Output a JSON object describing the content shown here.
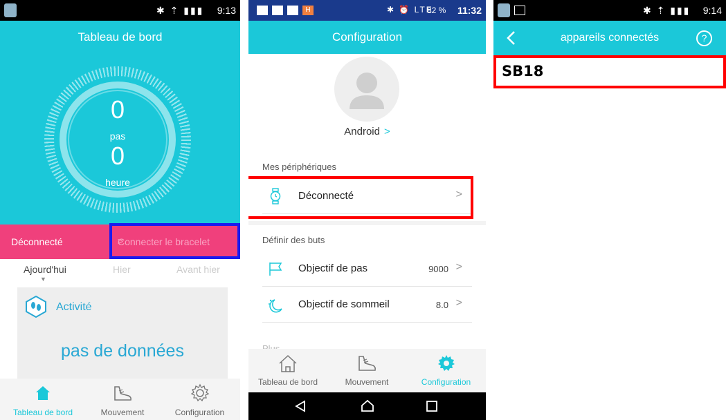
{
  "colors": {
    "accent": "#1bc8d9",
    "disconnect_bar": "#f0407c",
    "highlight_red": "#ff0000",
    "highlight_blue": "#1a1aee"
  },
  "phone1": {
    "status": {
      "icons": "✱ ⇡ ▮▮▮",
      "time": "9:13"
    },
    "title": "Tableau de bord",
    "steps_value": "0",
    "steps_label": "pas",
    "hours_value": "0",
    "hours_label": "heure",
    "status_text": "Déconnecté",
    "connect_label": "Connecter le bracelet",
    "connect_chevron": ">",
    "tabs": [
      "Ajourd'hui",
      "Hier",
      "Avant hier"
    ],
    "activity_title": "Activité",
    "no_data": "pas de données",
    "nav": [
      "Tableau de bord",
      "Mouvement",
      "Configuration"
    ]
  },
  "phone2": {
    "status": {
      "icons": "✱ ⏰ LTE",
      "battery": "82 %",
      "time": "11:32",
      "app_badge": "H"
    },
    "title": "Configuration",
    "username": "Android",
    "username_chevron": ">",
    "section_devices": "Mes périphériques",
    "device_status": "Déconnecté",
    "section_goals": "Définir des buts",
    "goal_steps_label": "Objectif de pas",
    "goal_steps_value": "9000",
    "goal_sleep_label": "Objectif de sommeil",
    "goal_sleep_value": "8.0",
    "row_chevron": ">",
    "section_more": "Plus",
    "nav": [
      "Tableau de bord",
      "Mouvement",
      "Configuration"
    ]
  },
  "phone3": {
    "status": {
      "icons": "✱ ⇡ ▮▮▮",
      "time": "9:14"
    },
    "title": "appareils connectés",
    "help": "?",
    "device_name": "SB18"
  }
}
